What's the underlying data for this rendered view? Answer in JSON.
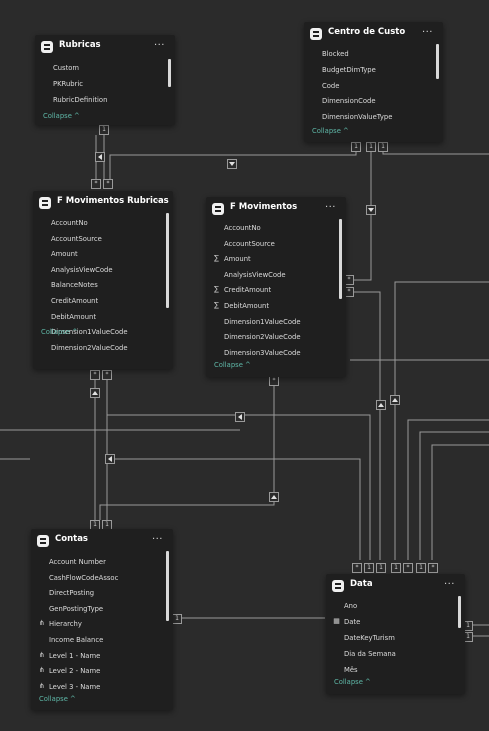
{
  "theme": {
    "canvas": "#2b2b2b",
    "card": "#1f1f1f",
    "accent": "#5fb8a8",
    "line": "#9a9a9a"
  },
  "tables": {
    "rubricas": {
      "title": "Rubricas",
      "more": "...",
      "collapse": "Collapse ^",
      "fields": [
        {
          "label": "Custom",
          "icon": ""
        },
        {
          "label": "PKRubric",
          "icon": ""
        },
        {
          "label": "RubricDefinition",
          "icon": ""
        }
      ]
    },
    "centro_custo": {
      "title": "Centro de Custo",
      "more": "...",
      "collapse": "Collapse ^",
      "fields": [
        {
          "label": "Blocked",
          "icon": ""
        },
        {
          "label": "BudgetDimType",
          "icon": ""
        },
        {
          "label": "Code",
          "icon": ""
        },
        {
          "label": "DimensionCode",
          "icon": ""
        },
        {
          "label": "DimensionValueType",
          "icon": ""
        }
      ]
    },
    "f_mov_rubricas": {
      "title": "F Movimentos Rubricas",
      "more": "...",
      "collapse": "Collapse ^",
      "fields": [
        {
          "label": "AccountNo",
          "icon": ""
        },
        {
          "label": "AccountSource",
          "icon": ""
        },
        {
          "label": "Amount",
          "icon": ""
        },
        {
          "label": "AnalysisViewCode",
          "icon": ""
        },
        {
          "label": "BalanceNotes",
          "icon": ""
        },
        {
          "label": "CreditAmount",
          "icon": ""
        },
        {
          "label": "DebitAmount",
          "icon": ""
        },
        {
          "label": "Dimension1ValueCode",
          "icon": ""
        },
        {
          "label": "Dimension2ValueCode",
          "icon": ""
        }
      ]
    },
    "f_mov": {
      "title": "F Movimentos",
      "more": "...",
      "collapse": "Collapse ^",
      "fields": [
        {
          "label": "AccountNo",
          "icon": ""
        },
        {
          "label": "AccountSource",
          "icon": ""
        },
        {
          "label": "Amount",
          "icon": "∑"
        },
        {
          "label": "AnalysisViewCode",
          "icon": ""
        },
        {
          "label": "CreditAmount",
          "icon": "∑"
        },
        {
          "label": "DebitAmount",
          "icon": "∑"
        },
        {
          "label": "Dimension1ValueCode",
          "icon": ""
        },
        {
          "label": "Dimension2ValueCode",
          "icon": ""
        },
        {
          "label": "Dimension3ValueCode",
          "icon": ""
        }
      ]
    },
    "contas": {
      "title": "Contas",
      "more": "...",
      "collapse": "Collapse ^",
      "fields": [
        {
          "label": "Account Number",
          "icon": ""
        },
        {
          "label": "CashFlowCodeAssoc",
          "icon": ""
        },
        {
          "label": "DirectPosting",
          "icon": ""
        },
        {
          "label": "GenPostingType",
          "icon": ""
        },
        {
          "label": "Hierarchy",
          "icon": "⋔"
        },
        {
          "label": "Income Balance",
          "icon": ""
        },
        {
          "label": "Level 1 - Name",
          "icon": "⋔"
        },
        {
          "label": "Level 2 - Name",
          "icon": "⋔"
        },
        {
          "label": "Level 3 - Name",
          "icon": "⋔"
        }
      ]
    },
    "data": {
      "title": "Data",
      "more": "...",
      "collapse": "Collapse ^",
      "fields": [
        {
          "label": "Ano",
          "icon": ""
        },
        {
          "label": "Date",
          "icon": "▦"
        },
        {
          "label": "DateKeyTurism",
          "icon": ""
        },
        {
          "label": "Dia da Semana",
          "icon": ""
        },
        {
          "label": "Mês",
          "icon": ""
        }
      ]
    }
  },
  "cardinality": {
    "one": "1",
    "many": "*"
  }
}
